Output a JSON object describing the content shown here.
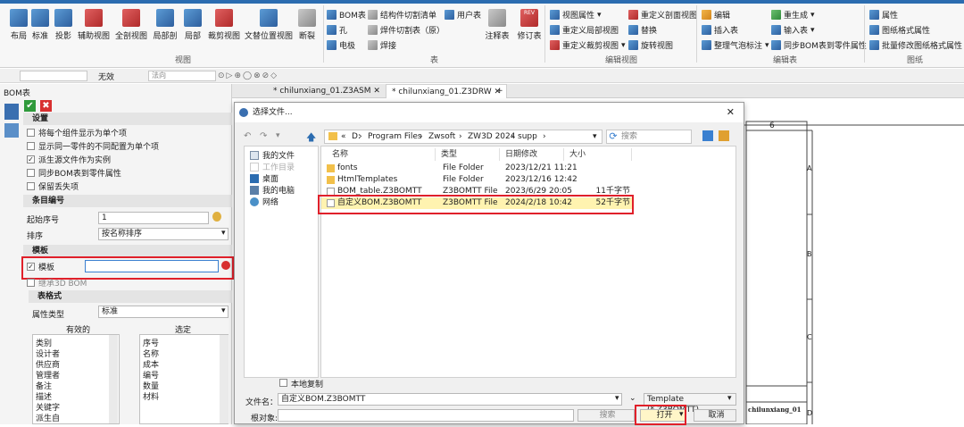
{
  "ribbon": {
    "view_buttons": [
      {
        "label": "布局",
        "icon": "layout-icon"
      },
      {
        "label": "标准",
        "icon": "standard-view-icon"
      },
      {
        "label": "投影",
        "icon": "projection-icon"
      },
      {
        "label": "辅助视图",
        "icon": "auxiliary-view-icon"
      },
      {
        "label": "全剖视图",
        "icon": "full-section-icon"
      },
      {
        "label": "局部剖",
        "icon": "local-section-icon"
      },
      {
        "label": "局部",
        "icon": "detail-view-icon"
      },
      {
        "label": "裁剪视图",
        "icon": "crop-view-icon"
      },
      {
        "label": "文替位置视图",
        "icon": "alt-position-view-icon"
      },
      {
        "label": "断裂",
        "icon": "break-view-icon"
      }
    ],
    "view_group": "视图",
    "table_items_col1": [
      "BOM表",
      "孔",
      "电极"
    ],
    "table_items_col2": [
      "结构件切割清单",
      "焊件切割表（原）",
      "焊接"
    ],
    "table_items_col3": [
      "用户表"
    ],
    "table_big": [
      {
        "label": "注释表",
        "icon": "annotation-table-icon"
      },
      {
        "label": "修订表",
        "icon": "revision-table-icon",
        "badge": "REV"
      }
    ],
    "table_group": "表",
    "edit_view_col1": [
      "视图属性",
      "重定义局部视图",
      "重定义裁剪视图"
    ],
    "edit_view_col2": [
      "重定义剖面视图",
      "替换",
      "旋转视图"
    ],
    "edit_view_group": "编辑视图",
    "edit_table_col1": [
      "编辑",
      "插入表",
      "整理气泡标注"
    ],
    "edit_table_col2": [
      "重生成",
      "输入表",
      "同步BOM表到零件属性"
    ],
    "edit_table_group": "编辑表",
    "frame_items": [
      "属性",
      "图纸格式属性",
      "批量修改图纸格式属性"
    ],
    "frame_group": "图纸"
  },
  "toolbar2": {
    "invalid_label": "无效",
    "direction_placeholder": "法向"
  },
  "tabs": [
    {
      "label": "* chilunxiang_01.Z3ASM"
    },
    {
      "label": "* chilunxiang_01.Z3DRW"
    }
  ],
  "panel": {
    "title": "BOM表",
    "settings_section": "设置",
    "settings_options": [
      {
        "label": "将每个组件显示为单个项",
        "checked": false
      },
      {
        "label": "显示同一零件的不同配置为单个项",
        "checked": false
      },
      {
        "label": "派生源文件作为实例",
        "checked": true
      },
      {
        "label": "同步BOM表到零件属性",
        "checked": false
      },
      {
        "label": "保留丢失项",
        "checked": false
      }
    ],
    "numbering_section": "条目编号",
    "start_label": "起始序号",
    "start_value": "1",
    "sort_label": "排序",
    "sort_value": "按名称排序",
    "template_section": "模板",
    "template_label": "模板",
    "inherit_label": "继承3D BOM",
    "table_format_section": "表格式",
    "attr_type_label": "属性类型",
    "attr_type_value": "标准",
    "valid_label": "有效的",
    "selected_label": "选定",
    "valid_list": [
      "类别",
      "设计者",
      "供应商",
      "管理者",
      "备注",
      "描述",
      "关键字",
      "派生自"
    ],
    "selected_list": [
      "序号",
      "名称",
      "成本",
      "编号",
      "数量",
      "材料"
    ]
  },
  "dialog": {
    "title": "选择文件...",
    "path": [
      "D:",
      "Program Files",
      "Zwsoft",
      "ZW3D 2024",
      "supp"
    ],
    "path_prefix": "«",
    "search_placeholder": "搜索",
    "nav": [
      "我的文件",
      "工作目录",
      "桌面",
      "我的电脑",
      "网络"
    ],
    "columns": [
      "名称",
      "类型",
      "日期修改",
      "大小"
    ],
    "files": [
      {
        "name": "fonts",
        "type": "File Folder",
        "date": "2023/12/21 11:21",
        "size": "",
        "kind": "folder"
      },
      {
        "name": "HtmlTemplates",
        "type": "File Folder",
        "date": "2023/12/16 12:42",
        "size": "",
        "kind": "folder"
      },
      {
        "name": "BOM_table.Z3BOMTT",
        "type": "Z3BOMTT File",
        "date": "2023/6/29 20:05",
        "size": "11千字节",
        "kind": "file"
      },
      {
        "name": "自定义BOM.Z3BOMTT",
        "type": "Z3BOMTT File",
        "date": "2024/2/18 10:42",
        "size": "52千字节",
        "kind": "file",
        "selected": true
      }
    ],
    "local_copy_label": "本地复制",
    "filename_label": "文件名：",
    "filename_value": "自定义BOM.Z3BOMTT",
    "filter_value": "Template (*.Z3BOMTT)",
    "root_label": "根对象:",
    "search_button": "搜索",
    "open_button": "打开",
    "cancel_button": "取消"
  },
  "drawing": {
    "column_number": "6",
    "row_letters": [
      "A",
      "B",
      "C",
      "D"
    ],
    "title_block_name": "chilunxiang_01"
  }
}
